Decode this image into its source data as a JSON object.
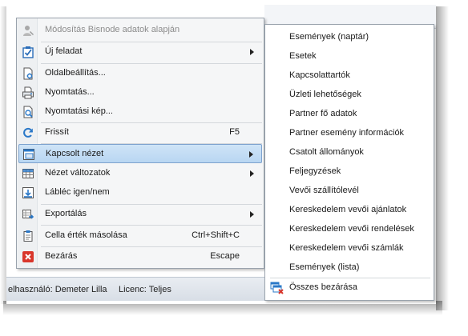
{
  "statusbar": {
    "user_text": "elhasználó: Demeter Lilla",
    "licence_text": "Licenc: Teljes"
  },
  "context_menu": {
    "items": [
      {
        "label": "Módosítás Bisnode adatok alapján",
        "shortcut": "",
        "disabled": true,
        "icon": "person-edit-icon"
      },
      {
        "label": "Új feladat",
        "shortcut": "",
        "submenu": true,
        "icon": "checkbox-task-icon"
      },
      {
        "label": "Oldalbeállítás...",
        "shortcut": "",
        "icon": "page-setup-icon"
      },
      {
        "label": "Nyomtatás...",
        "shortcut": "",
        "icon": "printer-icon"
      },
      {
        "label": "Nyomtatási kép...",
        "shortcut": "",
        "icon": "print-preview-icon"
      },
      {
        "label": "Frissít",
        "shortcut": "F5",
        "icon": "refresh-icon"
      },
      {
        "label": "Kapcsolt nézet",
        "shortcut": "",
        "submenu": true,
        "highlighted": true,
        "icon": "linked-view-icon"
      },
      {
        "label": "Nézet változatok",
        "shortcut": "",
        "submenu": true,
        "icon": "grid-view-icon"
      },
      {
        "label": "Lábléc igen/nem",
        "shortcut": "",
        "icon": "footer-toggle-icon"
      },
      {
        "label": "Exportálás",
        "shortcut": "",
        "submenu": true,
        "icon": "export-icon"
      },
      {
        "label": "Cella érték másolása",
        "shortcut": "Ctrl+Shift+C",
        "icon": "clipboard-icon"
      },
      {
        "label": "Bezárás",
        "shortcut": "Escape",
        "icon": "close-red-icon"
      }
    ]
  },
  "submenu": {
    "items": [
      "Események (naptár)",
      "Esetek",
      "Kapcsolattartók",
      "Üzleti lehetőségek",
      "Partner fő adatok",
      "Partner esemény információk",
      "Csatolt állományok",
      "Feljegyzések",
      "Vevői szállítólevél",
      "Kereskedelem vevői ajánlatok",
      "Kereskedelem vevői rendelések",
      "Kereskedelem vevői számlák",
      "Események (lista)"
    ],
    "close_all_label": "Összes bezárása",
    "close_all_icon": "close-all-windows-icon"
  },
  "colors": {
    "highlight": "#c6def5",
    "highlight_border": "#7da2ce",
    "menu_bg": "#f5f6f7",
    "close_red": "#d9362b",
    "icon_blue": "#2a78c8"
  }
}
